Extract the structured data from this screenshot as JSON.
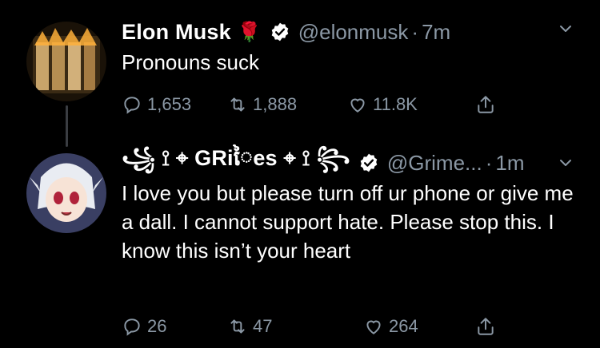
{
  "tweets": [
    {
      "name": "Elon Musk",
      "name_emoji": "🌹",
      "handle": "@elonmusk",
      "separator": "·",
      "time": "7m",
      "text": "Pronouns suck",
      "replies": "1,653",
      "retweets": "1,888",
      "likes": "11.8K"
    },
    {
      "name": "꧁ ⟟ ⌖ GRiៃes ⌖ ⟟ ꧂",
      "handle": "@Grime...",
      "separator": "·",
      "time": "1m",
      "text": "I love you but please turn off ur phone or give me a dall.  I cannot support hate. Please stop this. I know this isn’t your heart",
      "replies": "26",
      "retweets": "47",
      "likes": "264"
    }
  ],
  "colors": {
    "background": "#000000",
    "text": "#ffffff",
    "muted": "#8b98a5",
    "verified_badge": "#ffffff",
    "rose": "#d0142c"
  },
  "icons": [
    "verified-badge-icon",
    "chevron-down-icon",
    "reply-icon",
    "retweet-icon",
    "like-icon",
    "share-icon"
  ]
}
